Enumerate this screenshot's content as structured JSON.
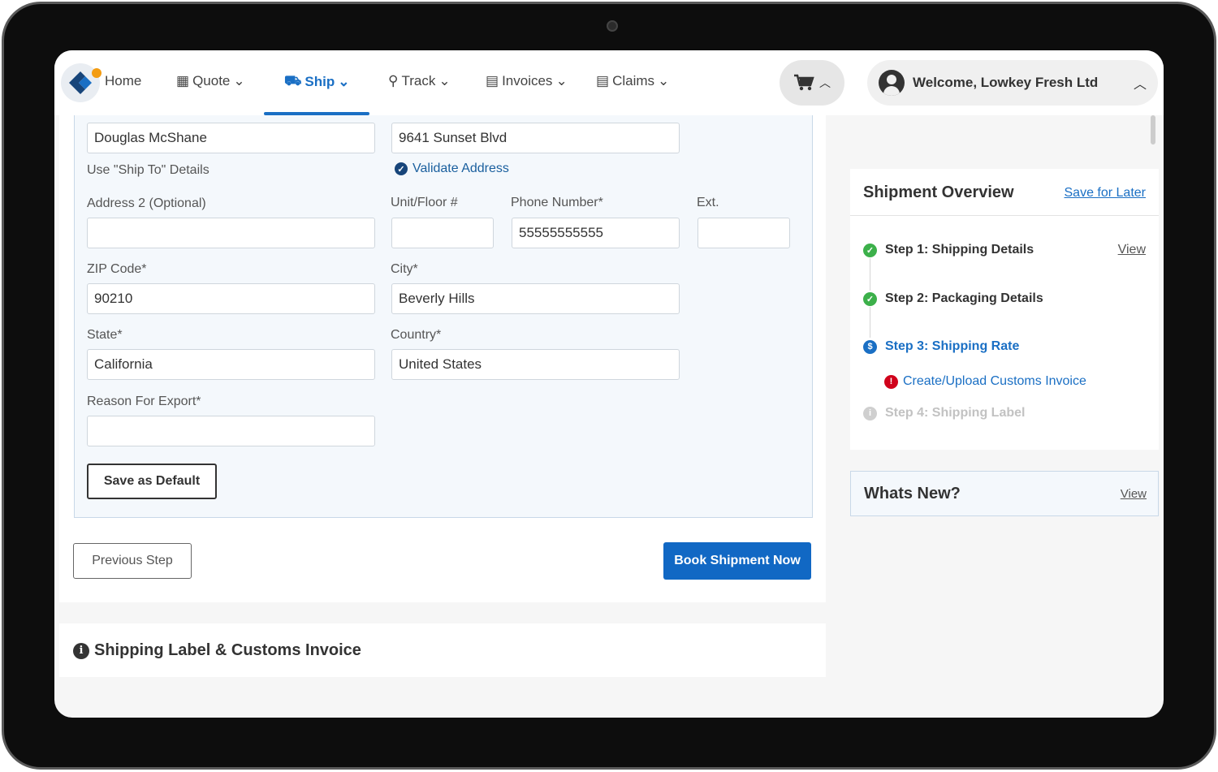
{
  "nav": {
    "home": "Home",
    "quote": "Quote",
    "ship": "Ship",
    "track": "Track",
    "invoices": "Invoices",
    "claims": "Claims",
    "welcome": "Welcome, Lowkey Fresh Ltd",
    "accent_color": "#1a6fc4"
  },
  "form": {
    "name_value": "Douglas McShane",
    "address_value": "9641 Sunset Blvd",
    "use_ship_to": "Use \"Ship To\" Details",
    "validate_address": "Validate Address",
    "address2_label": "Address 2 (Optional)",
    "address2_value": "",
    "unit_label": "Unit/Floor #",
    "unit_value": "",
    "phone_label": "Phone Number*",
    "phone_value": "55555555555",
    "ext_label": "Ext.",
    "ext_value": "",
    "zip_label": "ZIP Code*",
    "zip_value": "90210",
    "city_label": "City*",
    "city_value": "Beverly Hills",
    "state_label": "State*",
    "state_value": "California",
    "country_label": "Country*",
    "country_value": "United States",
    "reason_label": "Reason For Export*",
    "reason_value": "",
    "save_default": "Save as Default"
  },
  "actions": {
    "previous": "Previous Step",
    "book": "Book Shipment Now"
  },
  "label_section": {
    "title": "Shipping Label & Customs Invoice"
  },
  "overview": {
    "title": "Shipment Overview",
    "save_later": "Save for Later",
    "steps": [
      {
        "label": "Step 1: Shipping Details",
        "status": "complete",
        "action": "View"
      },
      {
        "label": "Step 2: Packaging Details",
        "status": "complete"
      },
      {
        "label": "Step 3: Shipping Rate",
        "status": "current"
      },
      {
        "label": "Create/Upload Customs Invoice",
        "status": "error"
      },
      {
        "label": "Step 4: Shipping Label",
        "status": "pending"
      }
    ]
  },
  "whats_new": {
    "title": "Whats New?",
    "view": "View"
  }
}
